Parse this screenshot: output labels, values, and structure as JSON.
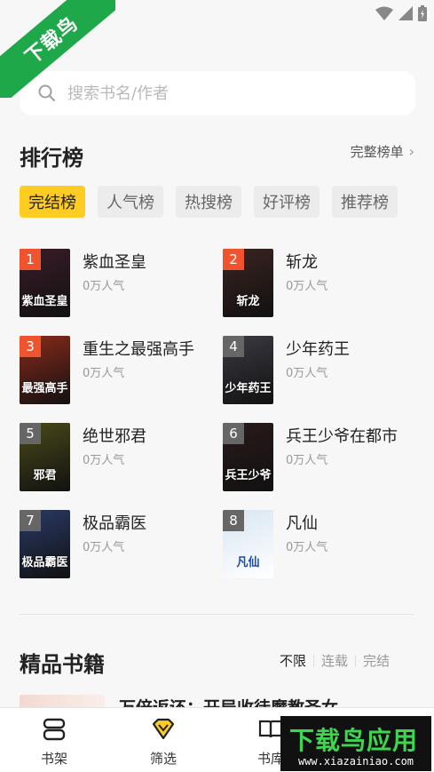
{
  "watermark_corner": "下载鸟",
  "search": {
    "placeholder": "搜索书名/作者"
  },
  "rank": {
    "title": "排行榜",
    "more_label": "完整榜单",
    "tabs": [
      "完结榜",
      "人气榜",
      "热搜榜",
      "好评榜",
      "推荐榜"
    ],
    "books": [
      {
        "rank": "1",
        "name": "紫血圣皇",
        "popularity": "0万人气",
        "cover_text": "紫血圣皇",
        "cover_color": "#3a1c28"
      },
      {
        "rank": "2",
        "name": "斩龙",
        "popularity": "0万人气",
        "cover_text": "斩龙",
        "cover_color": "#3b2420"
      },
      {
        "rank": "3",
        "name": "重生之最强高手",
        "popularity": "0万人气",
        "cover_text": "最强高手",
        "cover_color": "#8a2a1a"
      },
      {
        "rank": "4",
        "name": "少年药王",
        "popularity": "0万人气",
        "cover_text": "少年药王",
        "cover_color": "#3c3a44"
      },
      {
        "rank": "5",
        "name": "绝世邪君",
        "popularity": "0万人气",
        "cover_text": "邪君",
        "cover_color": "#4a4a1a"
      },
      {
        "rank": "6",
        "name": "兵王少爷在都市",
        "popularity": "0万人气",
        "cover_text": "兵王少爷",
        "cover_color": "#2a1a1a"
      },
      {
        "rank": "7",
        "name": "极品霸医",
        "popularity": "0万人气",
        "cover_text": "极品霸医",
        "cover_color": "#2a3a66"
      },
      {
        "rank": "8",
        "name": "凡仙",
        "popularity": "0万人气",
        "cover_text": "凡仙",
        "cover_color": "#d8e6f2"
      }
    ]
  },
  "fine": {
    "title": "精品书籍",
    "filters": [
      "不限",
      "连载",
      "完结"
    ],
    "peek_title": "万倍返还：开局收徒魔教圣女"
  },
  "nav": {
    "bookshelf": "书架",
    "filter": "筛选",
    "library": "书库"
  },
  "watermark": {
    "brand": "下载鸟应用",
    "url": "www.xiazainiao.com"
  },
  "colors": {
    "accent": "#ffcc22",
    "ribbon": "#1ea84a",
    "rank_badges": [
      "#f0542e",
      "#f0542e",
      "#f0542e",
      "#666666"
    ]
  }
}
